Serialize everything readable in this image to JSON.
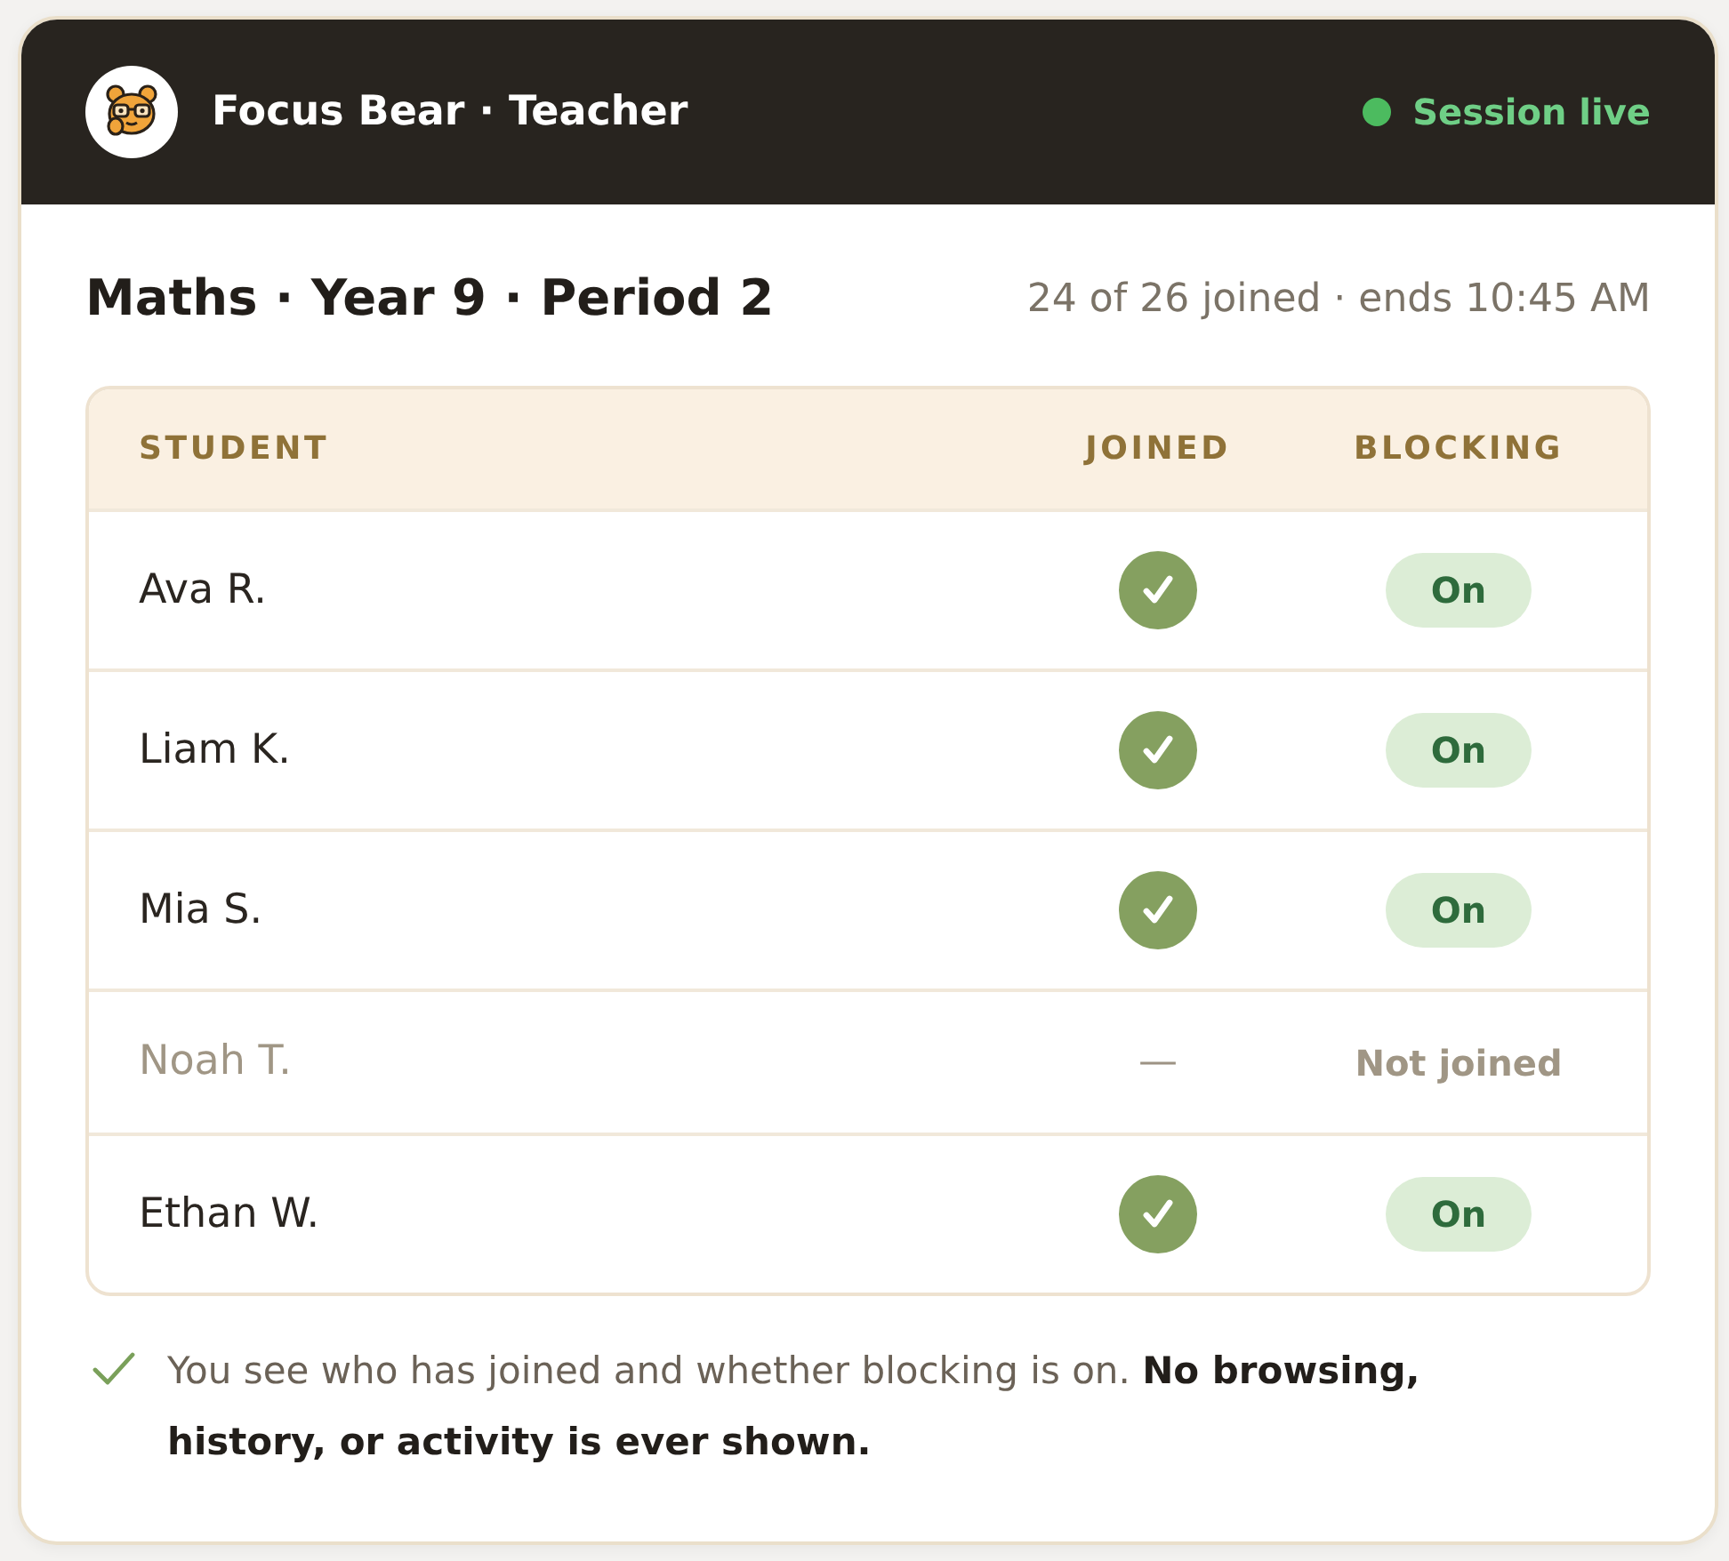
{
  "header": {
    "app_title": "Focus Bear · Teacher",
    "status": {
      "label": "Session live",
      "live": true
    }
  },
  "class": {
    "title": "Maths · Year 9 · Period 2",
    "meta": "24 of 26 joined · ends 10:45 AM"
  },
  "table": {
    "columns": [
      "STUDENT",
      "JOINED",
      "BLOCKING"
    ],
    "rows": [
      {
        "name": "Ava R.",
        "joined": true,
        "blocking": {
          "label": "On",
          "on": true
        }
      },
      {
        "name": "Liam K.",
        "joined": true,
        "blocking": {
          "label": "On",
          "on": true
        }
      },
      {
        "name": "Mia S.",
        "joined": true,
        "blocking": {
          "label": "On",
          "on": true
        }
      },
      {
        "name": "Noah T.",
        "joined": false,
        "joined_text": "—",
        "blocking": {
          "label": "Not joined",
          "on": false
        }
      },
      {
        "name": "Ethan W.",
        "joined": true,
        "blocking": {
          "label": "On",
          "on": true
        }
      }
    ]
  },
  "footer_note": "You see who has joined and whether blocking is on. **No browsing, history, or activity is ever shown.**"
}
